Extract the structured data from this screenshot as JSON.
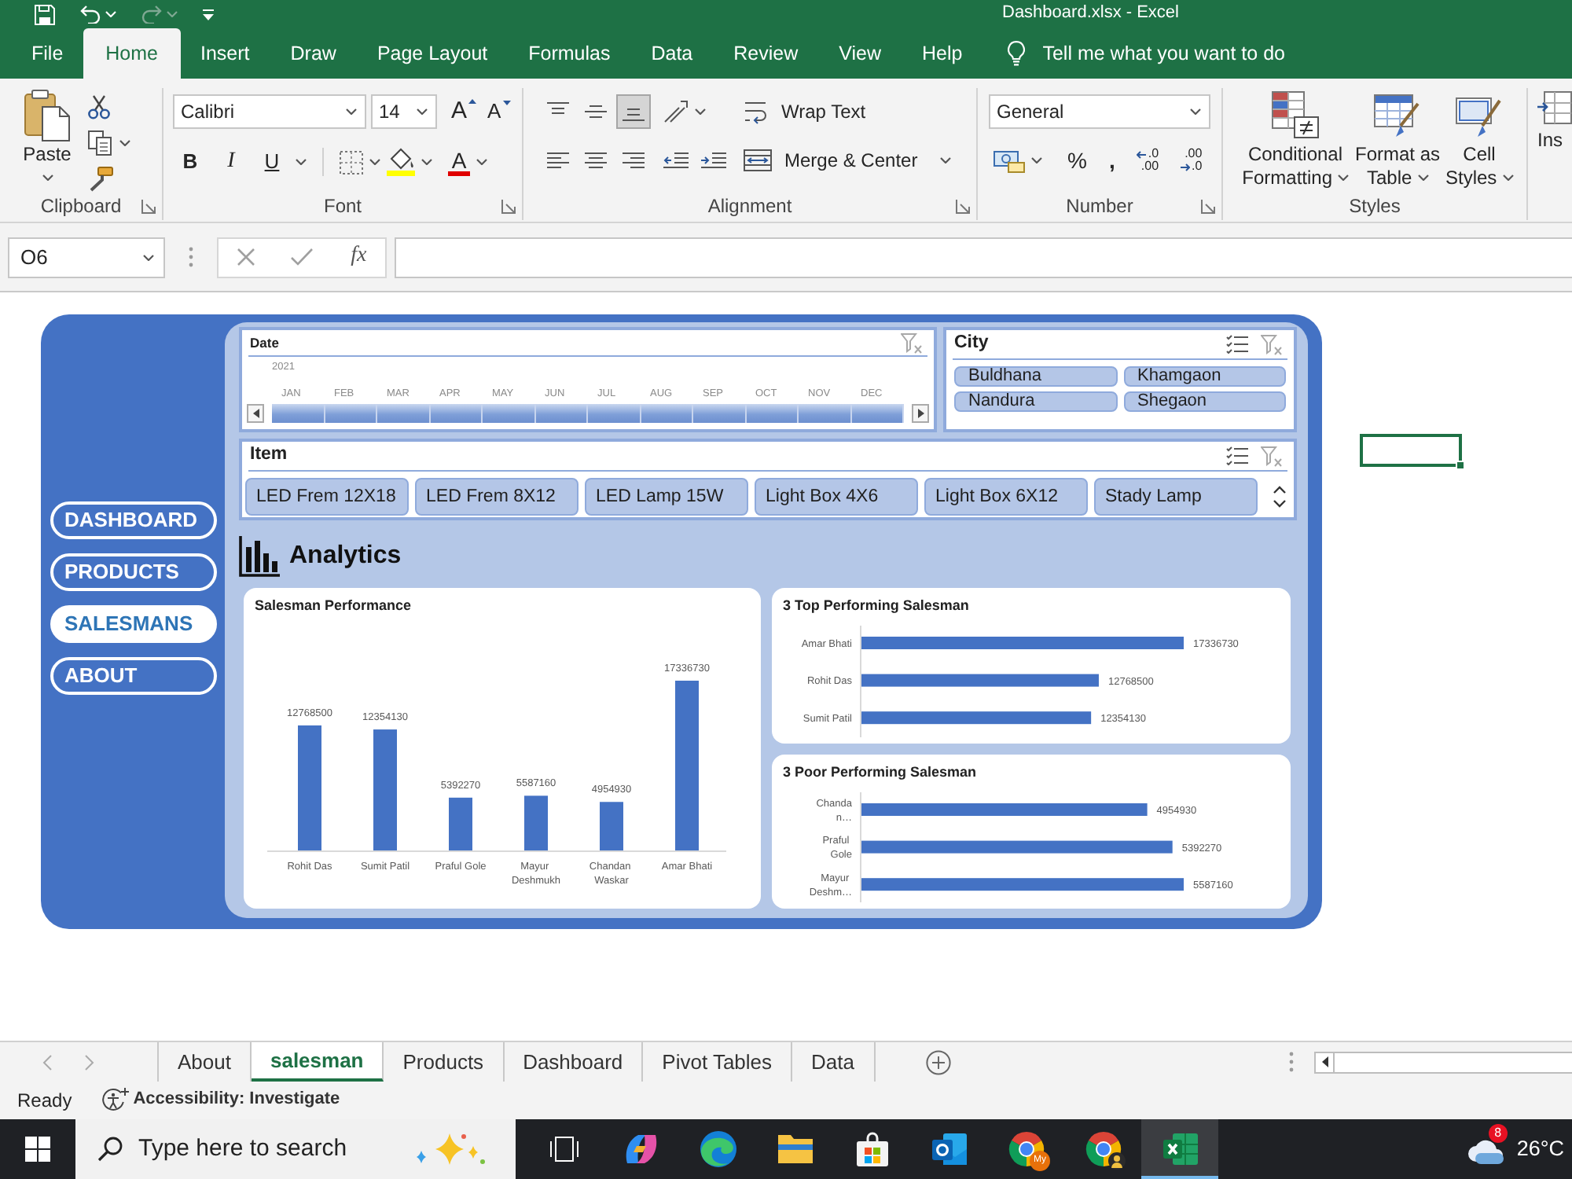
{
  "window": {
    "title": "Dashboard.xlsx - Excel"
  },
  "ribbon_tabs": [
    {
      "label": "File",
      "selected": false
    },
    {
      "label": "Home",
      "selected": true
    },
    {
      "label": "Insert",
      "selected": false
    },
    {
      "label": "Draw",
      "selected": false
    },
    {
      "label": "Page Layout",
      "selected": false
    },
    {
      "label": "Formulas",
      "selected": false
    },
    {
      "label": "Data",
      "selected": false
    },
    {
      "label": "Review",
      "selected": false
    },
    {
      "label": "View",
      "selected": false
    },
    {
      "label": "Help",
      "selected": false
    }
  ],
  "tell_me": "Tell me what you want to do",
  "ribbon": {
    "clipboard": {
      "paste": "Paste",
      "label": "Clipboard"
    },
    "font": {
      "name": "Calibri",
      "size": "14",
      "grow": "A",
      "shrink": "A",
      "styles": [
        {
          "label": "B",
          "kind": "bold"
        },
        {
          "label": "I",
          "kind": "italic"
        },
        {
          "label": "U",
          "kind": "underline"
        }
      ],
      "font_color_button": "A",
      "label": "Font"
    },
    "alignment": {
      "vertical": [
        {
          "kind": "top",
          "selected": false
        },
        {
          "kind": "middle",
          "selected": false
        },
        {
          "kind": "bottom",
          "selected": true
        }
      ],
      "wrap_text": "Wrap Text",
      "merge": "Merge & Center",
      "label": "Alignment"
    },
    "number": {
      "format": "General",
      "percent": "%",
      "comma": ",",
      "decimals": [
        {
          "kind": "increase",
          "lines": [
            ".0",
            ".00"
          ]
        },
        {
          "kind": "decrease",
          "lines": [
            ".00",
            ".0"
          ]
        }
      ],
      "label": "Number"
    },
    "styles": {
      "buttons": [
        {
          "kind": "conditional",
          "label": "Conditional Formatting"
        },
        {
          "kind": "table",
          "label": "Format as Table"
        },
        {
          "kind": "cell",
          "label": "Cell Styles"
        }
      ],
      "label": "Styles"
    },
    "cells": {
      "label": "Ins"
    }
  },
  "formula_bar": {
    "name_box": "O6",
    "function": "fx"
  },
  "dashboard": {
    "nav": [
      {
        "label": "DASHBOARD",
        "selected": false
      },
      {
        "label": "PRODUCTS",
        "selected": false
      },
      {
        "label": "SALESMANS",
        "selected": true
      },
      {
        "label": "ABOUT",
        "selected": false
      }
    ],
    "date_slicer": {
      "title": "Date",
      "year": "2021",
      "months": [
        {
          "label": "JAN",
          "selected": true
        },
        {
          "label": "FEB",
          "selected": true
        },
        {
          "label": "MAR",
          "selected": true
        },
        {
          "label": "APR",
          "selected": true
        },
        {
          "label": "MAY",
          "selected": true
        },
        {
          "label": "JUN",
          "selected": true
        },
        {
          "label": "JUL",
          "selected": true
        },
        {
          "label": "AUG",
          "selected": true
        },
        {
          "label": "SEP",
          "selected": true
        },
        {
          "label": "OCT",
          "selected": true
        },
        {
          "label": "NOV",
          "selected": true
        },
        {
          "label": "DEC",
          "selected": true
        }
      ]
    },
    "city_slicer": {
      "title": "City",
      "items": [
        {
          "label": "Buldhana",
          "selected": true
        },
        {
          "label": "Khamgaon",
          "selected": true
        },
        {
          "label": "Nandura",
          "selected": true
        },
        {
          "label": "Shegaon",
          "selected": true
        }
      ]
    },
    "item_slicer": {
      "title": "Item",
      "items": [
        {
          "label": "LED Frem 12X18",
          "selected": true
        },
        {
          "label": "LED Frem 8X12",
          "selected": true
        },
        {
          "label": "LED Lamp 15W",
          "selected": true
        },
        {
          "label": "Light Box 4X6",
          "selected": true
        },
        {
          "label": "Light Box 6X12",
          "selected": true
        },
        {
          "label": "Stady Lamp",
          "selected": true
        }
      ]
    },
    "heading": "Analytics",
    "charts": [
      {
        "chart_data": {
          "type": "bar",
          "title": "Salesman Performance",
          "categories": [
            "Rohit Das",
            "Sumit Patil",
            "Praful Gole",
            "Mayur Deshmukh",
            "Chandan Waskar",
            "Amar Bhati"
          ],
          "values": [
            12768500,
            12354130,
            5392270,
            5587160,
            4954930,
            17336730
          ],
          "color": "#4472c4",
          "data_labels": true
        }
      },
      {
        "chart_data": {
          "type": "bar",
          "orientation": "horizontal",
          "title": "3 Top Performing Salesman",
          "categories": [
            "Amar Bhati",
            "Rohit Das",
            "Sumit Patil"
          ],
          "values": [
            17336730,
            12768500,
            12354130
          ],
          "color": "#4472c4",
          "data_labels": true
        }
      },
      {
        "chart_data": {
          "type": "bar",
          "orientation": "horizontal",
          "title": "3 Poor Performing Salesman",
          "categories": [
            "Chandan…",
            "Praful Gole",
            "Mayur Deshm…"
          ],
          "values": [
            4954930,
            5392270,
            5587160
          ],
          "color": "#4472c4",
          "data_labels": true
        }
      }
    ]
  },
  "sheet_tabs": [
    {
      "label": "About",
      "selected": false
    },
    {
      "label": "salesman",
      "selected": true
    },
    {
      "label": "Products",
      "selected": false
    },
    {
      "label": "Dashboard",
      "selected": false
    },
    {
      "label": "Pivot Tables",
      "selected": false
    },
    {
      "label": "Data",
      "selected": false
    }
  ],
  "status_bar": {
    "mode": "Ready",
    "accessibility": "Accessibility: Investigate"
  },
  "taskbar": {
    "search": {
      "placeholder": "Type here to search"
    },
    "apps": [
      {
        "kind": "task-view",
        "active": false
      },
      {
        "kind": "copilot",
        "active": false
      },
      {
        "kind": "edge",
        "active": false
      },
      {
        "kind": "files",
        "active": false
      },
      {
        "kind": "store",
        "active": false
      },
      {
        "kind": "outlook",
        "active": false
      },
      {
        "kind": "chrome",
        "badge": "My",
        "active": false
      },
      {
        "kind": "chrome",
        "avatar": true,
        "active": false
      },
      {
        "kind": "excel",
        "active": true
      }
    ],
    "weather": {
      "badge": "8",
      "temperature": "26°C"
    }
  }
}
